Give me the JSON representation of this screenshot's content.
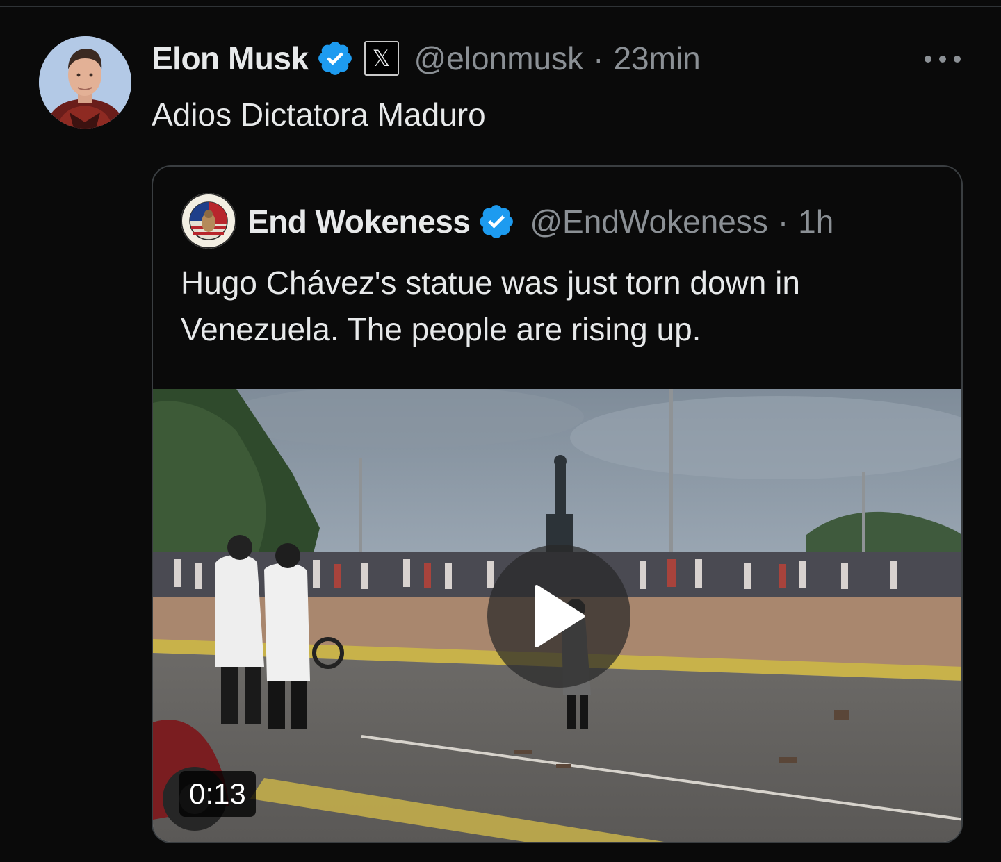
{
  "tweet": {
    "author_name": "Elon Musk",
    "author_handle": "@elonmusk",
    "separator": "·",
    "time": "23min",
    "text": "Adios Dictatora Maduro",
    "affiliation_glyph": "𝕏"
  },
  "quote": {
    "author_name": "End Wokeness",
    "author_handle": "@EndWokeness",
    "separator": "·",
    "time": "1h",
    "text": "Hugo Chávez's statue was just torn down in Venezuela. The people are rising up.",
    "video_duration": "0:13"
  },
  "colors": {
    "background": "#0a0a0a",
    "verified_blue": "#1d9bf0",
    "secondary_text": "#8b9095"
  },
  "icons": [
    "verified-badge-icon",
    "x-affiliation-icon",
    "more-options-icon",
    "play-icon"
  ]
}
